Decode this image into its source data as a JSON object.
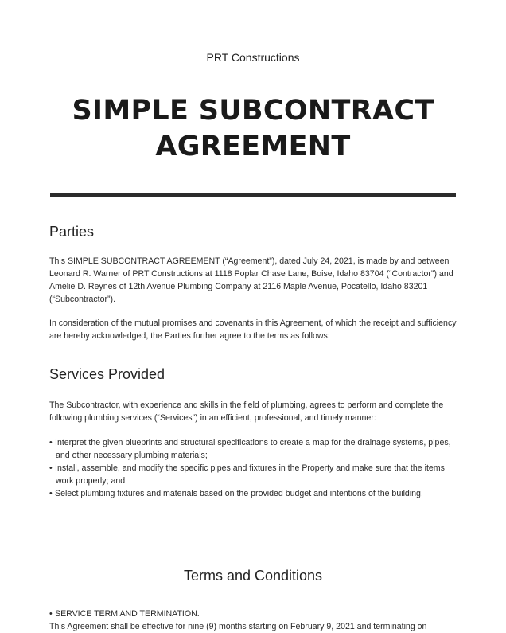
{
  "header": {
    "company": "PRT Constructions",
    "title_line1": "SIMPLE SUBCONTRACT",
    "title_line2": "AGREEMENT"
  },
  "parties": {
    "heading": "Parties",
    "p1": [
      "This SIMPLE SUBCONTRACT AGREEMENT (“Agreement”), dated July 24, 2021, is made by and between",
      "Leonard R. Warner of PRT Constructions at 1118 Poplar Chase Lane, Boise, Idaho 83704 (“Contractor”) and",
      "Amelie D. Reynes of 12th Avenue Plumbing Company at 2116 Maple Avenue, Pocatello, Idaho 83201",
      "(“Subcontractor”)."
    ],
    "p2": [
      "In consideration of the mutual promises and covenants in this Agreement, of which the receipt and sufficiency",
      "are hereby acknowledged, the Parties further agree to the terms as follows:"
    ]
  },
  "services": {
    "heading": "Services Provided",
    "intro": [
      "The Subcontractor, with experience and skills in the field of plumbing, agrees to perform and complete the",
      "following plumbing services (“Services”) in an efficient, professional, and timely manner:"
    ],
    "bullets": [
      [
        "Interpret the given blueprints and structural specifications to create a map for the drainage systems, pipes,",
        "and other necessary plumbing materials;"
      ],
      [
        "Install, assemble, and modify the specific pipes and fixtures in the Property and make sure that the items",
        "work properly; and"
      ],
      [
        "Select plumbing fixtures and materials based on the provided budget and intentions of the building."
      ]
    ]
  },
  "terms": {
    "heading": "Terms and Conditions",
    "item1_title": "SERVICE TERM AND TERMINATION.",
    "item1_text": "This Agreement shall be effective for nine (9) months starting on February 9, 2021 and terminating on"
  }
}
